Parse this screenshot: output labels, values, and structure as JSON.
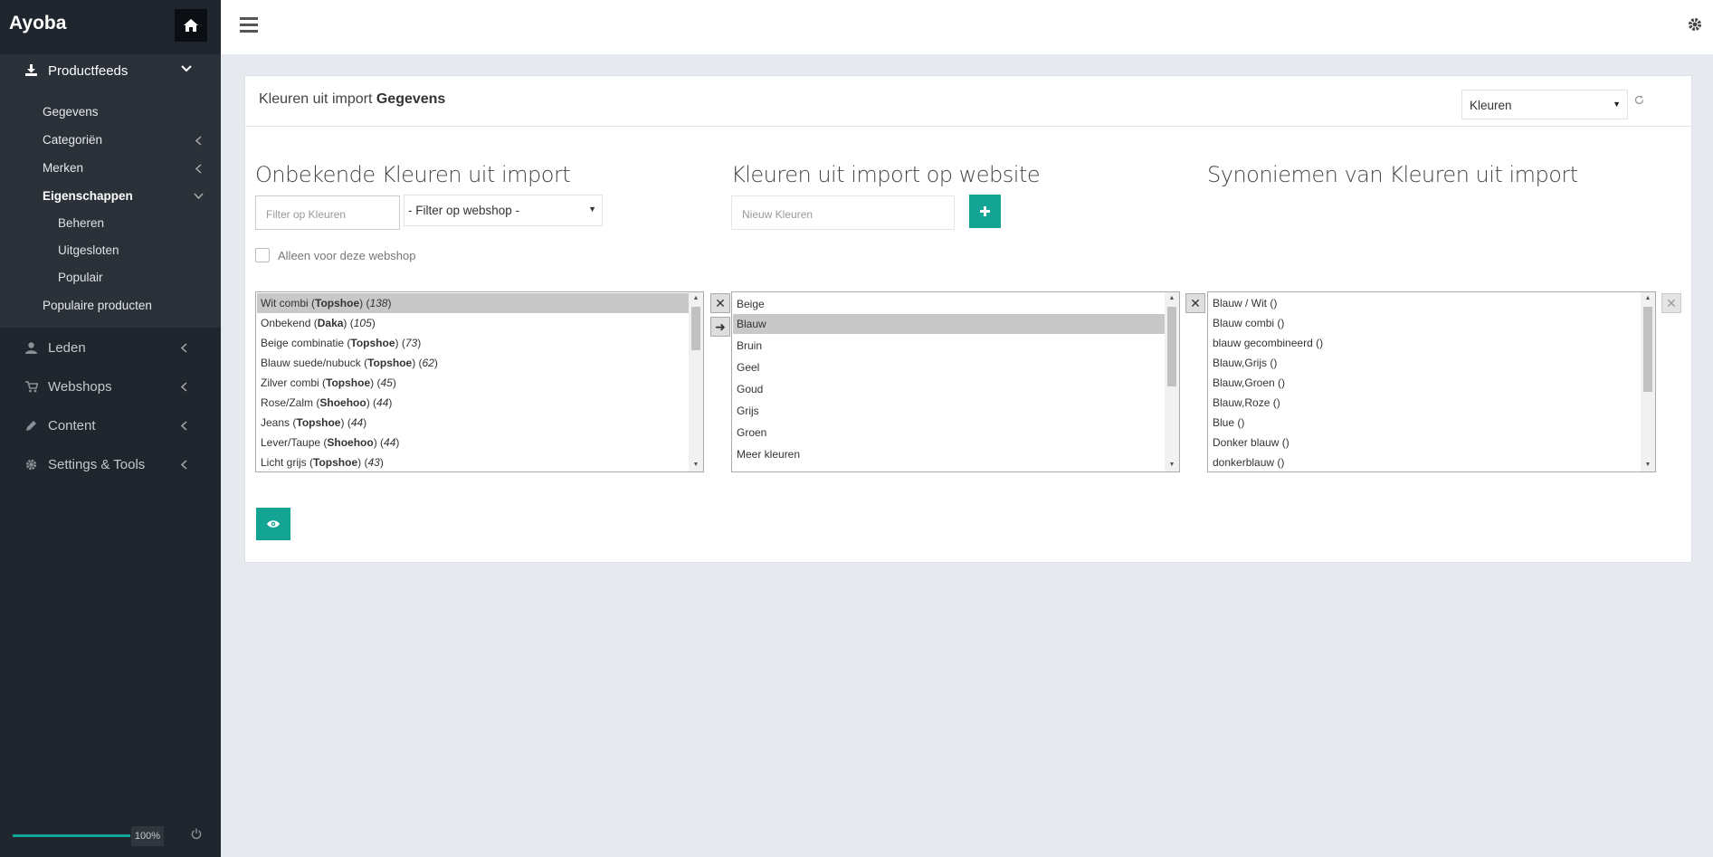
{
  "app": {
    "brand": "Ayoba"
  },
  "sidebar": {
    "main_section": {
      "label": "Productfeeds"
    },
    "sub_items": [
      {
        "label": "Gegevens"
      },
      {
        "label": "Categoriën"
      },
      {
        "label": "Merken"
      },
      {
        "label": "Eigenschappen"
      },
      {
        "label": "Beheren"
      },
      {
        "label": "Uitgesloten"
      },
      {
        "label": "Populair"
      },
      {
        "label": "Populaire producten"
      }
    ],
    "items": [
      {
        "label": "Leden",
        "icon": "user-icon"
      },
      {
        "label": "Webshops",
        "icon": "cart-icon"
      },
      {
        "label": "Content",
        "icon": "pencil-icon"
      },
      {
        "label": "Settings & Tools",
        "icon": "gear-icon"
      }
    ],
    "progress": {
      "value": 100,
      "label": "100%"
    }
  },
  "panel": {
    "title_prefix": "Kleuren uit import ",
    "title_bold": "Gegevens",
    "select_value": "Kleuren"
  },
  "columns": {
    "unknown": {
      "title": "Onbekende Kleuren uit import",
      "filter_placeholder": "Filter op Kleuren",
      "webshop_select": "- Filter op webshop -",
      "checkbox_label": "Alleen voor deze webshop",
      "rows": [
        {
          "name": "Wit combi",
          "shop": "Topshoe",
          "count": "138",
          "selected": true
        },
        {
          "name": "Onbekend",
          "shop": "Daka",
          "count": "105"
        },
        {
          "name": "Beige combinatie",
          "shop": "Topshoe",
          "count": "73"
        },
        {
          "name": "Blauw suede/nubuck",
          "shop": "Topshoe",
          "count": "62"
        },
        {
          "name": "Zilver combi",
          "shop": "Topshoe",
          "count": "45"
        },
        {
          "name": "Rose/Zalm",
          "shop": "Shoehoo",
          "count": "44"
        },
        {
          "name": "Jeans",
          "shop": "Topshoe",
          "count": "44"
        },
        {
          "name": "Lever/Taupe",
          "shop": "Shoehoo",
          "count": "44"
        },
        {
          "name": "Licht grijs",
          "shop": "Topshoe",
          "count": "43"
        }
      ]
    },
    "website": {
      "title": "Kleuren uit import op website",
      "new_placeholder": "Nieuw Kleuren",
      "rows": [
        "Beige",
        "Blauw",
        "Bruin",
        "Geel",
        "Goud",
        "Grijs",
        "Groen",
        "Meer kleuren"
      ],
      "selected_index": 1
    },
    "synonyms": {
      "title": "Synoniemen van Kleuren uit import",
      "rows": [
        "Blauw / Wit ()",
        "Blauw combi ()",
        "blauw gecombineerd ()",
        "Blauw,Grijs ()",
        "Blauw,Groen ()",
        "Blauw,Roze ()",
        "Blue ()",
        "Donker blauw ()",
        "donkerblauw ()"
      ]
    }
  },
  "colors": {
    "accent": "#13a493",
    "sidebar_bg": "#1f262d"
  }
}
